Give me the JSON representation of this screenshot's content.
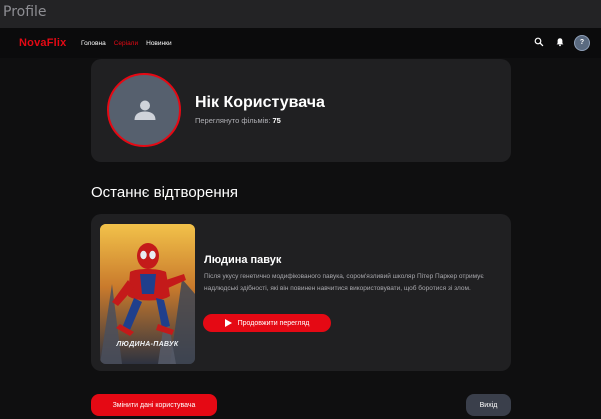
{
  "window": {
    "title": "Profile"
  },
  "nav": {
    "logo": "NovaFlix",
    "links": [
      {
        "label": "Головна",
        "active": false
      },
      {
        "label": "Серіали",
        "active": true
      },
      {
        "label": "Новинки",
        "active": false
      }
    ],
    "search_icon": "search-icon",
    "bell_icon": "bell-icon",
    "avatar_text": "?"
  },
  "profile": {
    "nickname": "Нік Користувача",
    "watched_label": "Переглянуто фільмів:",
    "watched_count": "75",
    "avatar_icon": "user-icon"
  },
  "recent": {
    "section_title": "Останнє відтворення",
    "poster_caption": "ЛЮДИНА-ПАВУК",
    "title": "Людина павук",
    "description": "Після укусу генетично модифікованого павука, сором'язливий школяр Пітер Паркер отримує надлюдські здібності, які він повинен навчитися використовувати, щоб боротися зі злом.",
    "continue_label": "Продовжити перегляд",
    "play_icon": "play-icon"
  },
  "actions": {
    "edit_label": "Змінити дані користувача",
    "logout_label": "Вихід"
  },
  "colors": {
    "accent": "#e50914",
    "background": "#0f0f10",
    "card": "#202022"
  }
}
